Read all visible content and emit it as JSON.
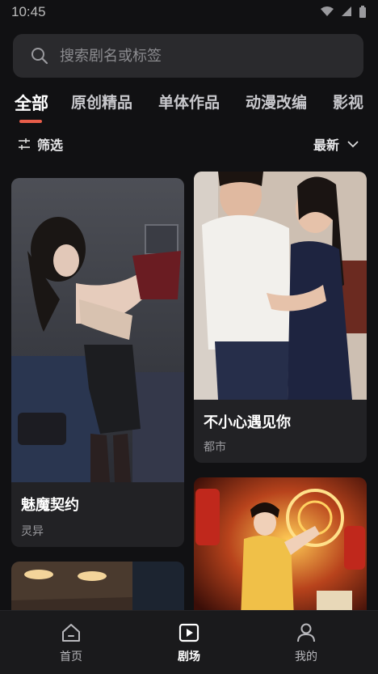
{
  "status_bar": {
    "time": "10:45"
  },
  "search": {
    "placeholder": "搜索剧名或标签"
  },
  "tabs": [
    {
      "label": "全部",
      "active": true
    },
    {
      "label": "原创精品"
    },
    {
      "label": "单体作品"
    },
    {
      "label": "动漫改编"
    },
    {
      "label": "影视"
    }
  ],
  "toolbar": {
    "filter_label": "筛选",
    "sort_label": "最新"
  },
  "cards": [
    {
      "title": "魅魔契约",
      "tag": "灵异"
    },
    {
      "title": "不小心遇见你",
      "tag": "都市"
    },
    {
      "title": "",
      "tag": ""
    },
    {
      "title": "",
      "tag": ""
    }
  ],
  "bottom_nav": [
    {
      "label": "首页",
      "icon": "home-icon"
    },
    {
      "label": "剧场",
      "icon": "play-icon",
      "active": true
    },
    {
      "label": "我的",
      "icon": "person-icon"
    }
  ],
  "colors": {
    "accent": "#e85d4a",
    "background": "#111113",
    "card": "#222225"
  }
}
